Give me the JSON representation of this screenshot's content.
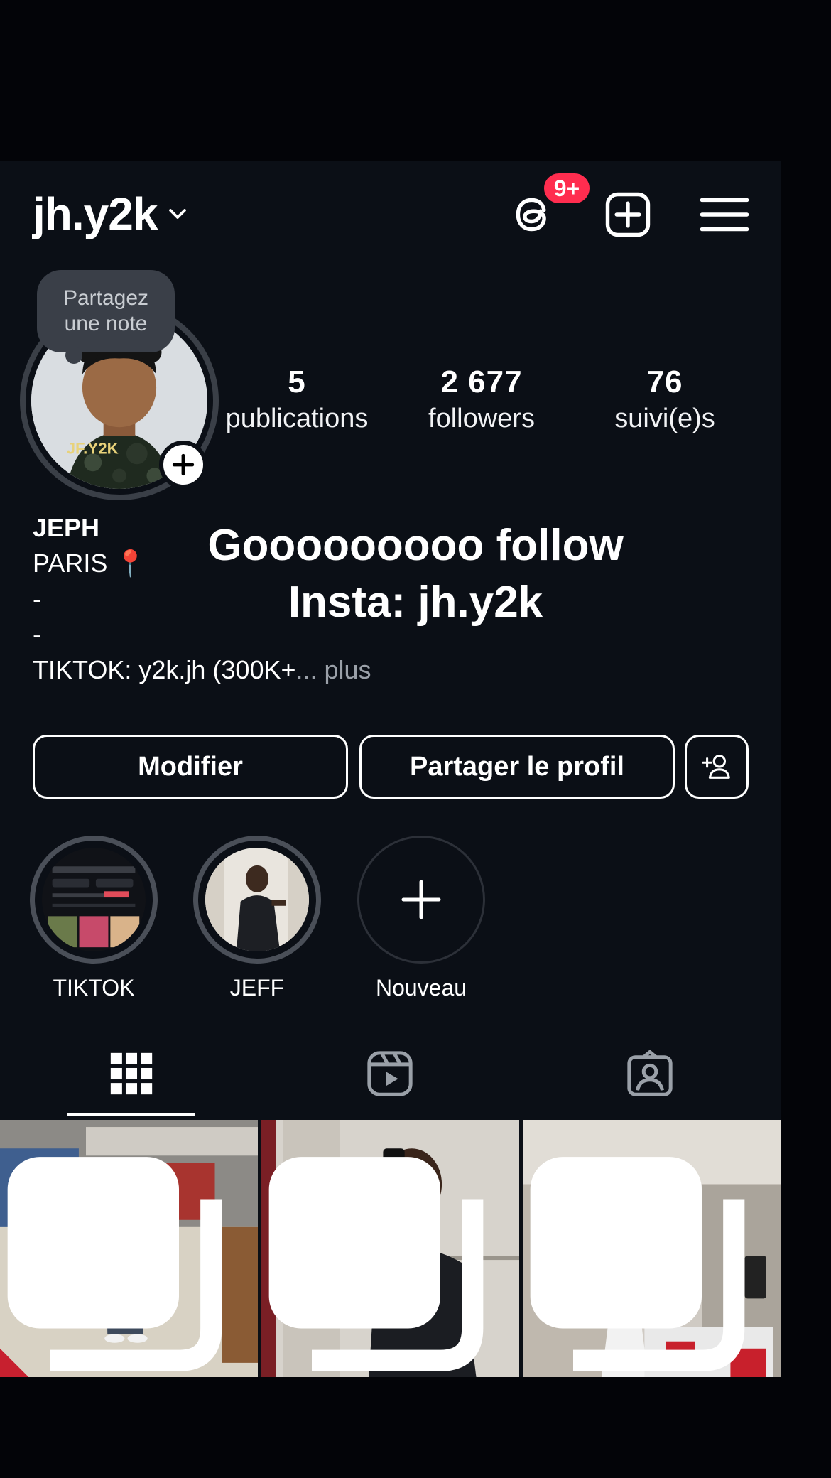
{
  "header": {
    "username": "jh.y2k",
    "notification_badge": "9+",
    "icons": [
      "threads-icon",
      "add-post-icon",
      "hamburger-menu-icon"
    ]
  },
  "profile": {
    "note_bubble": "Partagez une note",
    "avatar_text": "JF.Y2K",
    "stats": {
      "posts_count": "5",
      "posts_label": "publications",
      "followers_count": "2 677",
      "followers_label": "followers",
      "following_count": "76",
      "following_label": "suivi(e)s"
    },
    "bio": {
      "name": "JEPH",
      "line1": "PARIS 📍",
      "line2": "-",
      "line3": "-",
      "line4": "TIKTOK: y2k.jh (300K+",
      "more": "... plus"
    }
  },
  "overlay": {
    "line1": "Gooooooooo follow",
    "line2": "Insta: jh.y2k"
  },
  "buttons": {
    "edit": "Modifier",
    "share": "Partager le profil"
  },
  "highlights": [
    {
      "label": "TIKTOK"
    },
    {
      "label": "JEFF"
    },
    {
      "label": "Nouveau"
    }
  ],
  "tabs": [
    "grid-icon",
    "reels-icon",
    "tagged-icon"
  ],
  "colors": {
    "background": "#0b0f16",
    "badge": "#ff2d4f",
    "text": "#ffffff",
    "muted": "#9aa0a8"
  }
}
